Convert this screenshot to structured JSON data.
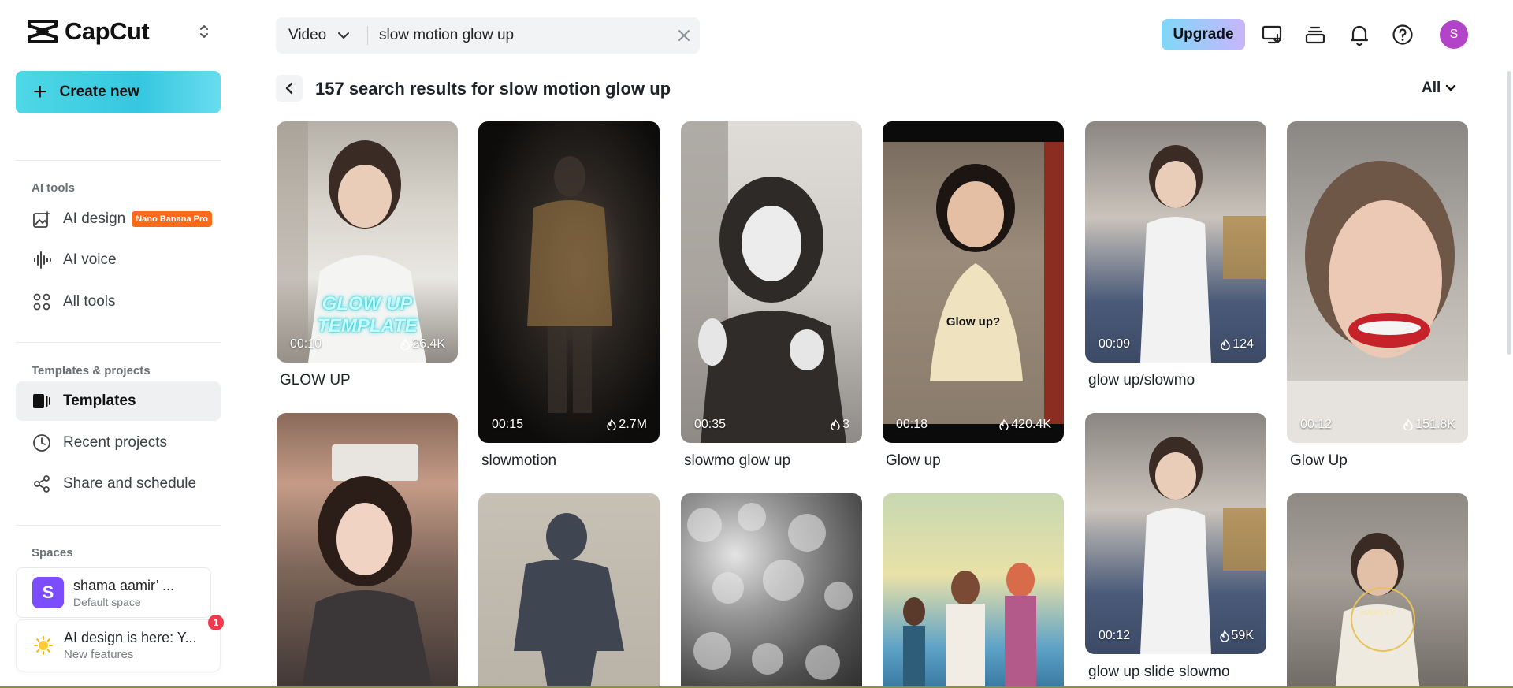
{
  "app": {
    "name": "CapCut"
  },
  "sidebar": {
    "create_label": "Create new",
    "ai_tools_title": "AI tools",
    "ai_tools": [
      {
        "label": "AI design",
        "badge": "Nano Banana Pro",
        "icon": "image-sparkle-icon"
      },
      {
        "label": "AI voice",
        "icon": "voice-wave-icon"
      },
      {
        "label": "All tools",
        "icon": "grid-dots-icon"
      }
    ],
    "templates_title": "Templates & projects",
    "templates_items": [
      {
        "label": "Templates",
        "icon": "templates-icon",
        "active": true
      },
      {
        "label": "Recent projects",
        "icon": "clock-icon"
      },
      {
        "label": "Share and schedule",
        "icon": "share-icon"
      }
    ],
    "spaces_title": "Spaces",
    "space": {
      "initial": "S",
      "name": "shama aamir’ ...",
      "subtitle": "Default space"
    },
    "feature": {
      "title": "AI design is here: Y...",
      "subtitle": "New features",
      "count": "1"
    }
  },
  "topbar": {
    "search_type": "Video",
    "search_query": "slow motion glow up",
    "upgrade_label": "Upgrade",
    "avatar_initial": "S"
  },
  "results": {
    "title": "157 search results for slow motion glow up",
    "filter_label": "All"
  },
  "cards": [
    {
      "title": "GLOW UP",
      "duration": "00:10",
      "views": "26.4K",
      "overlay": "GLOW UP\nTEMPLATE"
    },
    {
      "title": "slowmotion",
      "duration": "00:15",
      "views": "2.7M"
    },
    {
      "title": "slowmo glow up",
      "duration": "00:35",
      "views": "3"
    },
    {
      "title": "Glow up",
      "duration": "00:18",
      "views": "420.4K",
      "overlay": "Glow up?"
    },
    {
      "title": "glow up/slowmo",
      "duration": "00:09",
      "views": "124"
    },
    {
      "title": "Glow Up",
      "duration": "00:12",
      "views": "151.8K"
    },
    {
      "title": "glow up slide slowmo",
      "duration": "00:12",
      "views": "59K"
    },
    {
      "title": "",
      "duration": "",
      "views": "",
      "overlay": "AWAYYY"
    }
  ],
  "colors": {
    "accent": "#35c7e0",
    "badge": "#ff6a1a",
    "avatar": "#b343c9",
    "space": "#7c4dff"
  }
}
